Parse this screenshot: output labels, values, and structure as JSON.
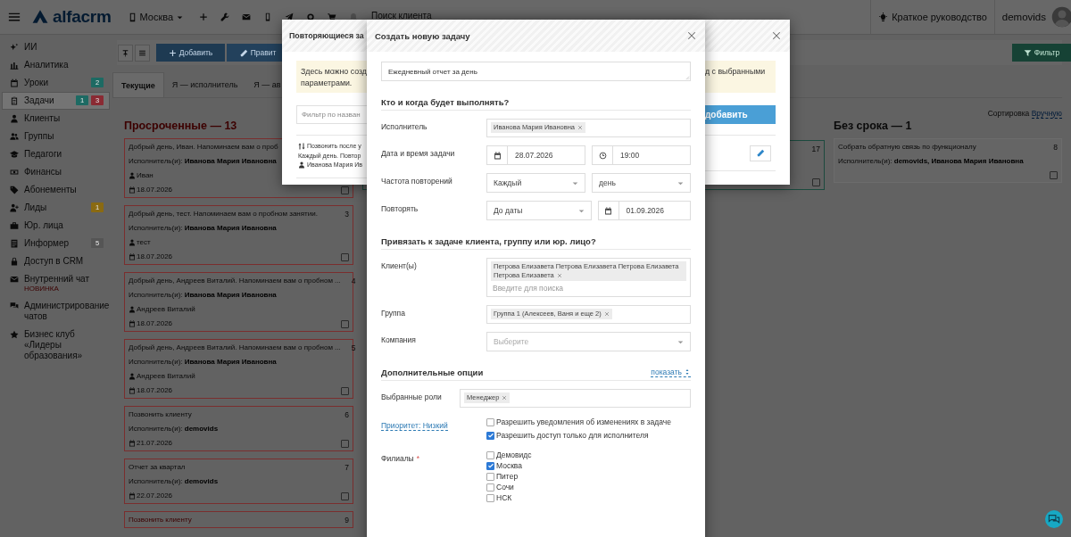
{
  "topbar": {
    "logo": "alfacrm",
    "branch": "Москва",
    "search_placeholder": "Поиск клиента",
    "guide": "Краткое руководство",
    "user": "demovids"
  },
  "sidebar": {
    "items": [
      {
        "label": "ИИ",
        "selected": false
      },
      {
        "label": "Аналитика",
        "selected": false
      },
      {
        "label": "Уроки",
        "selected": false,
        "badges": [
          {
            "text": "2",
            "color": "#1d6a63"
          }
        ]
      },
      {
        "label": "Задачи",
        "selected": true,
        "badges": [
          {
            "text": "1",
            "color": "#1d6a63"
          },
          {
            "text": "3",
            "color": "#8a2a33"
          }
        ]
      },
      {
        "label": "Клиенты",
        "selected": false
      },
      {
        "label": "Группы",
        "selected": false
      },
      {
        "label": "Педагоги",
        "selected": false
      },
      {
        "label": "Финансы",
        "selected": false
      },
      {
        "label": "Абонементы",
        "selected": false
      },
      {
        "label": "Лиды",
        "selected": false,
        "badges": [
          {
            "text": "1",
            "color": "#8a6a12"
          }
        ]
      },
      {
        "label": "Юр. лица",
        "selected": false
      },
      {
        "label": "Информер",
        "selected": false,
        "badges": [
          {
            "text": "5",
            "color": "#555555"
          }
        ]
      },
      {
        "label": "Доступ в CRM",
        "selected": false
      },
      {
        "label": "Внутренний чат",
        "selected": false,
        "note": "НОВИНКА"
      },
      {
        "label": "Администрирование чатов",
        "selected": false
      },
      {
        "label": "Бизнес клуб «Лидеры образования»",
        "selected": false
      }
    ]
  },
  "toolbar": {
    "buttons": [
      {
        "label": "Добавить",
        "kind": "add"
      },
      {
        "label": "Правит",
        "kind": "edit"
      }
    ],
    "filter": "Фильтр"
  },
  "tabs": [
    {
      "label": "Текущие",
      "selected": true
    },
    {
      "label": "Я — исполнитель",
      "selected": false
    },
    {
      "label": "Я — ав",
      "selected": false
    }
  ],
  "sorting": {
    "label": "Сортировка",
    "value": "Вручную"
  },
  "overdue": {
    "title": "Просроченные — 13",
    "cards": [
      {
        "title": "Добрый день, Иван. Напоминаем вам о проб",
        "assignee": "Исполнитель(и): **Иванова Мария Ивановна**",
        "client": "Иван",
        "date": "18.07.2026",
        "checked": false,
        "alert": false
      },
      {
        "title": "Добрый день, тест. Напоминаем вам о пробном занятии.",
        "number": "3",
        "assignee": "Исполнитель(и): **Иванова Мария Ивановна**",
        "client": "тест",
        "date": "18.07.2026",
        "checked": false,
        "alert": false
      },
      {
        "title": "Добрый день, Андреев Виталий. Напоминаем вам о пробном ...",
        "number": "4",
        "assignee": "Исполнитель(и): **Иванова Мария Ивановна**",
        "client": "Андреев Виталий",
        "date": "18.07.2026",
        "checked": false,
        "alert": false
      },
      {
        "title": "Добрый день, Андреев Виталий. Напоминаем вам о пробном ...",
        "number": "5",
        "assignee": "Исполнитель(и): **Иванова Мария Ивановна**",
        "client": "Андреев Виталий",
        "date": "18.07.2026",
        "checked": false,
        "alert": false
      },
      {
        "title": "Позвонить клиенту",
        "number": "6",
        "assignee": "Исполнитель(и): **demovids**",
        "date": "21.07.2026",
        "checked": false,
        "alert": false
      },
      {
        "title": "Отчет за квартал",
        "number": "7",
        "assignee": "Исполнитель(и): **demovids**",
        "date": "22.07.2026",
        "checked": false,
        "alert": false
      },
      {
        "title": "Позвонить клиенту",
        "number": "9",
        "alert": true
      }
    ]
  },
  "middle_card": {
    "number": "17",
    "checked": false
  },
  "no_deadline": {
    "title": "Без срока — 1",
    "cards": [
      {
        "title": "Собрать обратную связь по функционалу",
        "number": "8",
        "assignee": "Исполнитель(и): **demovids, Иванова Мария Ивановна**",
        "checked": false
      }
    ]
  },
  "recurring_modal": {
    "title": "Повторяющиеся за",
    "notice_left": "Здесь можно созд",
    "notice_left_2": "параметрами.",
    "notice_right": "д с выбранными",
    "filter_placeholder": "Фильтр по назван",
    "add_button": "добавить",
    "item": {
      "title": "Позвонить после у",
      "schedule": "Каждый день. Повтор",
      "assignee": "Иванова Мария Ив"
    }
  },
  "create_modal": {
    "title": "Создать новую задачу",
    "description": "Ежедневный отчет за день",
    "who_when": {
      "heading": "Кто и когда будет выполнять?",
      "assignee_label": "Исполнитель",
      "assignees": [
        "Иванова Мария Ивановна"
      ],
      "datetime_label": "Дата и время задачи",
      "date": "28.07.2026",
      "time": "19:00",
      "frequency_label": "Частота повторений",
      "frequency": "Каждый",
      "period": "день",
      "repeat_label": "Повторять",
      "repeat": "До даты",
      "end_date": "01.09.2026"
    },
    "link": {
      "heading": "Привязать к задаче клиента, группу или юр. лицо?",
      "clients_label": "Клиент(ы)",
      "clients": [
        "Петрова Елизавета Петрова Елизавета Петрова Елизавета Петрова Елизавета"
      ],
      "clients_placeholder": "Введите для поиска",
      "group_label": "Группа",
      "groups": [
        "Группа 1 (Алексеев, Ваня и еще 2)"
      ],
      "company_label": "Компания",
      "company_placeholder": "Выберите"
    },
    "extra": {
      "heading": "Дополнительные опции",
      "toggle": "показать",
      "roles_label": "Выбранные роли",
      "roles": [
        "Менеджер"
      ],
      "priority": "Приоритет: Низкий",
      "options": [
        {
          "label": "Разрешить уведомления об изменениях в задаче",
          "checked": false
        },
        {
          "label": "Разрешить доступ только для исполнителя",
          "checked": true
        }
      ],
      "branches_label": "Филиалы",
      "required_mark": "*",
      "branches": [
        {
          "label": "Демовидс",
          "checked": false
        },
        {
          "label": "Москва",
          "checked": true
        },
        {
          "label": "Питер",
          "checked": false
        },
        {
          "label": "Сочи",
          "checked": false
        },
        {
          "label": "НСК",
          "checked": false
        }
      ]
    }
  }
}
